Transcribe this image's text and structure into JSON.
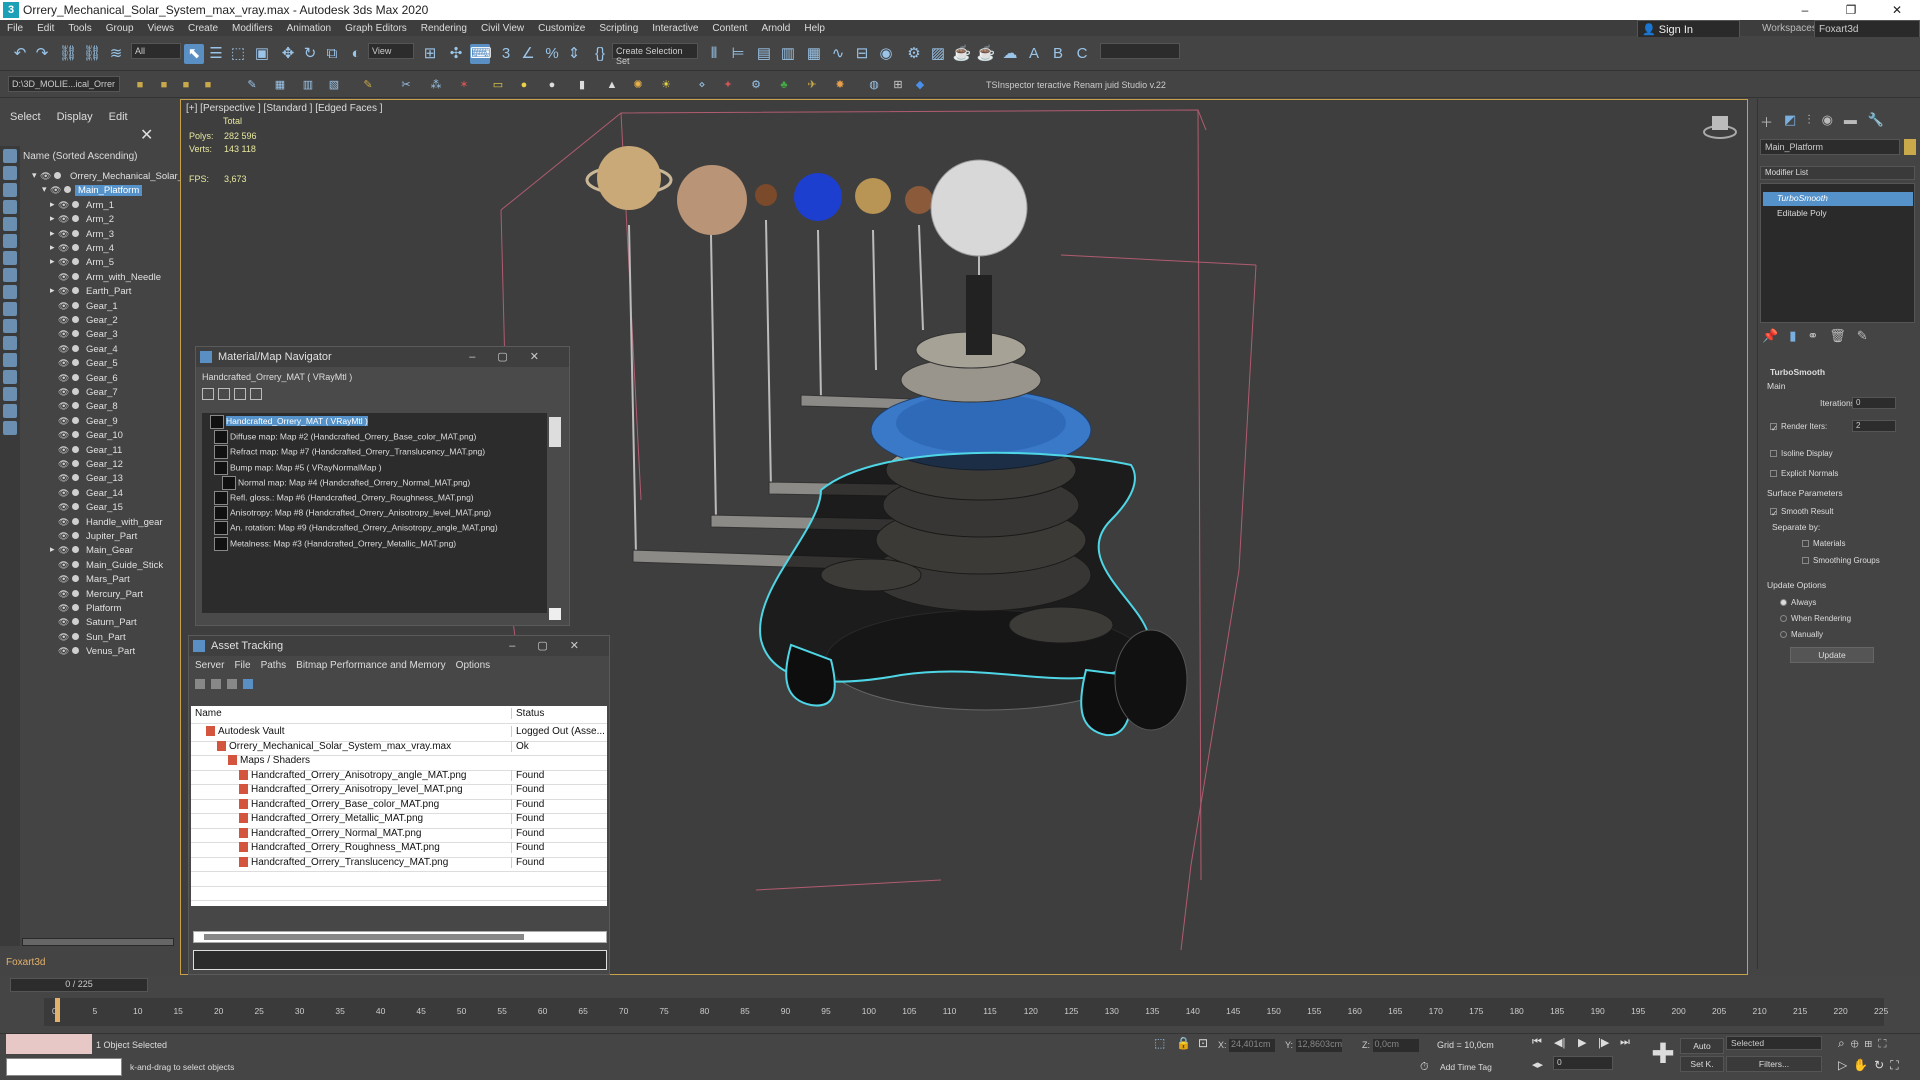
{
  "window": {
    "title": "Orrery_Mechanical_Solar_System_max_vray.max - Autodesk 3ds Max 2020",
    "controls": [
      "–",
      "❐",
      "✕"
    ]
  },
  "menu": [
    "File",
    "Edit",
    "Tools",
    "Group",
    "Views",
    "Create",
    "Modifiers",
    "Animation",
    "Graph Editors",
    "Rendering",
    "Civil View",
    "Customize",
    "Scripting",
    "Interactive",
    "Content",
    "Arnold",
    "Help"
  ],
  "signin": {
    "label": "Sign In",
    "workspaces_label": "Workspaces:",
    "workspace": "Foxart3d"
  },
  "toolbar": {
    "filter": "All",
    "view": "View",
    "selection_set": "Create Selection Set",
    "path": "D:\\3D_MOLIE...ical_Orrer",
    "tabs_text": "TSInspector   teractive Renam  juid Studio v.22"
  },
  "scene": {
    "tabs": [
      "Select",
      "Display",
      "Edit"
    ],
    "header": "Name (Sorted Ascending)",
    "items": [
      {
        "name": "Orrery_Mechanical_Solar_Sy",
        "level": 0,
        "expand": "▾"
      },
      {
        "name": "Main_Platform",
        "level": 1,
        "expand": "▾",
        "selected": true
      },
      {
        "name": "Arm_1",
        "level": 2,
        "expand": "▸"
      },
      {
        "name": "Arm_2",
        "level": 2,
        "expand": "▸"
      },
      {
        "name": "Arm_3",
        "level": 2,
        "expand": "▸"
      },
      {
        "name": "Arm_4",
        "level": 2,
        "expand": "▸"
      },
      {
        "name": "Arm_5",
        "level": 2,
        "expand": "▸"
      },
      {
        "name": "Arm_with_Needle",
        "level": 2,
        "expand": ""
      },
      {
        "name": "Earth_Part",
        "level": 2,
        "expand": "▸"
      },
      {
        "name": "Gear_1",
        "level": 2,
        "expand": ""
      },
      {
        "name": "Gear_2",
        "level": 2,
        "expand": ""
      },
      {
        "name": "Gear_3",
        "level": 2,
        "expand": ""
      },
      {
        "name": "Gear_4",
        "level": 2,
        "expand": ""
      },
      {
        "name": "Gear_5",
        "level": 2,
        "expand": ""
      },
      {
        "name": "Gear_6",
        "level": 2,
        "expand": ""
      },
      {
        "name": "Gear_7",
        "level": 2,
        "expand": ""
      },
      {
        "name": "Gear_8",
        "level": 2,
        "expand": ""
      },
      {
        "name": "Gear_9",
        "level": 2,
        "expand": ""
      },
      {
        "name": "Gear_10",
        "level": 2,
        "expand": ""
      },
      {
        "name": "Gear_11",
        "level": 2,
        "expand": ""
      },
      {
        "name": "Gear_12",
        "level": 2,
        "expand": ""
      },
      {
        "name": "Gear_13",
        "level": 2,
        "expand": ""
      },
      {
        "name": "Gear_14",
        "level": 2,
        "expand": ""
      },
      {
        "name": "Gear_15",
        "level": 2,
        "expand": ""
      },
      {
        "name": "Handle_with_gear",
        "level": 2,
        "expand": ""
      },
      {
        "name": "Jupiter_Part",
        "level": 2,
        "expand": ""
      },
      {
        "name": "Main_Gear",
        "level": 2,
        "expand": "▸"
      },
      {
        "name": "Main_Guide_Stick",
        "level": 2,
        "expand": ""
      },
      {
        "name": "Mars_Part",
        "level": 2,
        "expand": ""
      },
      {
        "name": "Mercury_Part",
        "level": 2,
        "expand": ""
      },
      {
        "name": "Platform",
        "level": 2,
        "expand": ""
      },
      {
        "name": "Saturn_Part",
        "level": 2,
        "expand": ""
      },
      {
        "name": "Sun_Part",
        "level": 2,
        "expand": ""
      },
      {
        "name": "Venus_Part",
        "level": 2,
        "expand": ""
      }
    ],
    "user": "Foxart3d"
  },
  "viewport": {
    "label": "[+] [Perspective ] [Standard ] [Edged Faces ]",
    "total_label": "Total",
    "polys_label": "Polys:",
    "polys": "282 596",
    "verts_label": "Verts:",
    "verts": "143 118",
    "fps_label": "FPS:",
    "fps": "3,673"
  },
  "material_nav": {
    "title": "Material/Map Navigator",
    "subtitle": "Handcrafted_Orrery_MAT  ( VRayMtl )",
    "rows": [
      {
        "text": "Handcrafted_Orrery_MAT  ( VRayMtl )",
        "selected": true
      },
      {
        "text": "Diffuse map: Map #2 (Handcrafted_Orrery_Base_color_MAT.png)"
      },
      {
        "text": "Refract map: Map #7 (Handcrafted_Orrery_Translucency_MAT.png)"
      },
      {
        "text": "Bump map: Map #5  ( VRayNormalMap )"
      },
      {
        "text": "Normal map: Map #4 (Handcrafted_Orrery_Normal_MAT.png)"
      },
      {
        "text": "Refl. gloss.: Map #6 (Handcrafted_Orrery_Roughness_MAT.png)"
      },
      {
        "text": "Anisotropy: Map #8 (Handcrafted_Orrery_Anisotropy_level_MAT.png)"
      },
      {
        "text": "An. rotation: Map #9 (Handcrafted_Orrery_Anisotropy_angle_MAT.png)"
      },
      {
        "text": "Metalness: Map #3 (Handcrafted_Orrery_Metallic_MAT.png)"
      }
    ]
  },
  "asset_tracking": {
    "title": "Asset Tracking",
    "menu": [
      "Server",
      "File",
      "Paths",
      "Bitmap Performance and Memory",
      "Options"
    ],
    "columns": [
      "Name",
      "Status"
    ],
    "rows": [
      {
        "name": "Autodesk Vault",
        "status": "Logged Out (Asse...",
        "indent": 1
      },
      {
        "name": "Orrery_Mechanical_Solar_System_max_vray.max",
        "status": "Ok",
        "indent": 2
      },
      {
        "name": "Maps / Shaders",
        "status": "",
        "indent": 3
      },
      {
        "name": "Handcrafted_Orrery_Anisotropy_angle_MAT.png",
        "status": "Found",
        "indent": 4
      },
      {
        "name": "Handcrafted_Orrery_Anisotropy_level_MAT.png",
        "status": "Found",
        "indent": 4
      },
      {
        "name": "Handcrafted_Orrery_Base_color_MAT.png",
        "status": "Found",
        "indent": 4
      },
      {
        "name": "Handcrafted_Orrery_Metallic_MAT.png",
        "status": "Found",
        "indent": 4
      },
      {
        "name": "Handcrafted_Orrery_Normal_MAT.png",
        "status": "Found",
        "indent": 4
      },
      {
        "name": "Handcrafted_Orrery_Roughness_MAT.png",
        "status": "Found",
        "indent": 4
      },
      {
        "name": "Handcrafted_Orrery_Translucency_MAT.png",
        "status": "Found",
        "indent": 4
      }
    ]
  },
  "command_panel": {
    "object_name": "Main_Platform",
    "modifier_list": "Modifier List",
    "stack": [
      {
        "name": "TurboSmooth",
        "selected": true
      },
      {
        "name": "Editable Poly"
      }
    ],
    "turbosmooth": "TurboSmooth",
    "main": "Main",
    "iterations_label": "Iterations:",
    "iterations": "0",
    "render_iters_label": "Render Iters:",
    "render_iters": "2",
    "isoline": "Isoline Display",
    "explicit_normals": "Explicit Normals",
    "surface_params": "Surface Parameters",
    "smooth_result": "Smooth Result",
    "separate_by": "Separate by:",
    "materials": "Materials",
    "smoothing_groups": "Smoothing Groups",
    "update_options": "Update Options",
    "always": "Always",
    "when_rendering": "When Rendering",
    "manually": "Manually",
    "update": "Update"
  },
  "timeline": {
    "frame": "0 / 225",
    "ticks": [
      "0",
      "5",
      "10",
      "15",
      "20",
      "25",
      "30",
      "35",
      "40",
      "45",
      "50",
      "55",
      "60",
      "65",
      "70",
      "75",
      "80",
      "85",
      "90",
      "95",
      "100",
      "105",
      "110",
      "115",
      "120",
      "125",
      "130",
      "135",
      "140",
      "145",
      "150",
      "155",
      "160",
      "165",
      "170",
      "175",
      "180",
      "185",
      "190",
      "195",
      "200",
      "205",
      "210",
      "215",
      "220",
      "225"
    ]
  },
  "status": {
    "selected": "1 Object Selected",
    "prompt": "k-and-drag to select objects",
    "x_label": "X:",
    "x": "24,401cm",
    "y_label": "Y:",
    "y": "12,8603cm",
    "z_label": "Z:",
    "z": "0,0cm",
    "grid": "Grid = 10,0cm",
    "add_time_tag": "Add Time Tag",
    "auto": "Auto",
    "set_k": "Set K.",
    "key_filter": "Selected",
    "filters": "Filters...",
    "frame_input": "0"
  },
  "colors": {
    "selection": "#5592c9",
    "wire": "#4fd6e6",
    "viewport_border": "#c8a24a",
    "bbox": "#b05c70"
  }
}
